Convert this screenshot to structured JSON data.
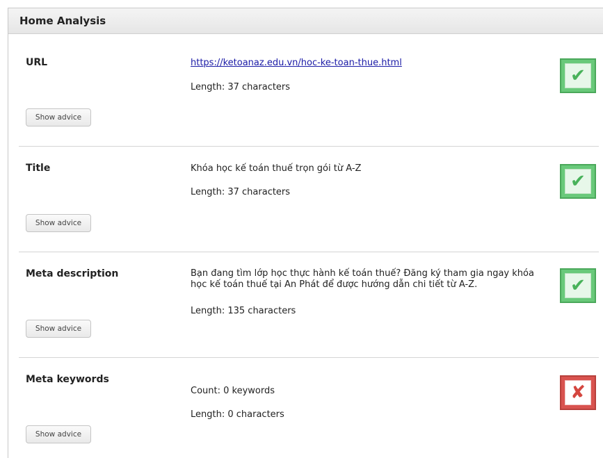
{
  "header": {
    "title": "Home Analysis"
  },
  "advice_label": "Show advice",
  "colors": {
    "pass": "#69c97a",
    "fail": "#d9534f",
    "link": "#1a1aa6"
  },
  "rows": [
    {
      "label": "URL",
      "link": "https://ketoanaz.edu.vn/hoc-ke-toan-thue.html",
      "length": "Length: 37 characters",
      "status": "pass",
      "icon": "check-icon",
      "glyph": "✔"
    },
    {
      "label": "Title",
      "text": "Khóa học kế toán thuế trọn gói từ A-Z",
      "length": "Length: 37 characters",
      "status": "pass",
      "icon": "check-icon",
      "glyph": "✔"
    },
    {
      "label": "Meta description",
      "text": "Bạn đang tìm lớp học thực hành kế toán thuế? Đăng ký tham gia ngay khóa học kế toán thuế tại An Phát để được hướng dẫn chi tiết từ A-Z.",
      "length": "Length: 135 characters",
      "status": "pass",
      "icon": "check-icon",
      "glyph": "✔"
    },
    {
      "label": "Meta keywords",
      "count": "Count: 0 keywords",
      "length": "Length: 0 characters",
      "status": "fail",
      "icon": "cross-icon",
      "glyph": "✘"
    }
  ]
}
